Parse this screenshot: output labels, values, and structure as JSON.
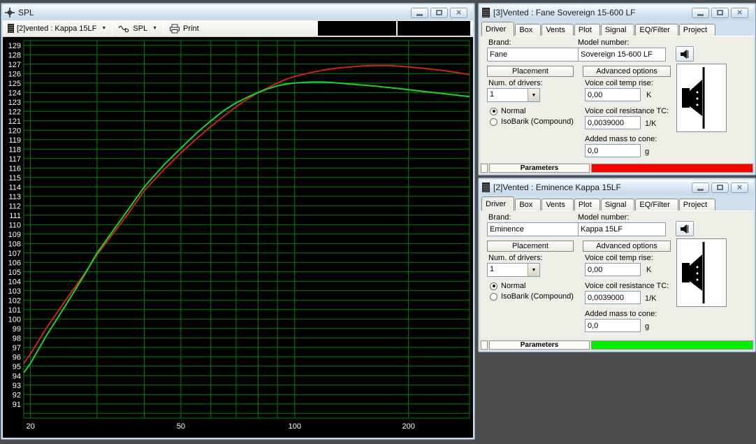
{
  "icons": {
    "dropdown_arrow": "▼",
    "close": "×"
  },
  "spl_window": {
    "title": "SPL",
    "toolbar": {
      "project_selector": "[2]vented : Kappa 15LF",
      "graph_selector": "SPL",
      "print_label": "Print"
    }
  },
  "driver_windows": [
    {
      "title": "[3]Vented : Fane Sovereign 15-600 LF",
      "tabs": [
        "Driver",
        "Box",
        "Vents",
        "Plot",
        "Signal",
        "EQ/Filter",
        "Project"
      ],
      "active_tab": "Driver",
      "brand_label": "Brand:",
      "brand": "Fane",
      "model_label": "Model number:",
      "model": "Sovereign 15-600 LF",
      "placement_button": "Placement",
      "advanced_button": "Advanced options",
      "num_drivers_label": "Num. of drivers:",
      "num_drivers": "1",
      "radio_normal": "Normal",
      "radio_isobarik": "IsoBarik (Compound)",
      "vc_temp_label": "Voice coil temp rise:",
      "vc_temp_value": "0,00",
      "vc_temp_unit": "K",
      "vc_res_label": "Voice coil resistance TC:",
      "vc_res_value": "0,0039000",
      "vc_res_unit": "1/K",
      "added_mass_label": "Added mass to cone:",
      "added_mass_value": "0,0",
      "added_mass_unit": "g",
      "status_label": "Parameters",
      "status_color": "#fd0000"
    },
    {
      "title": "[2]Vented : Eminence Kappa 15LF",
      "tabs": [
        "Driver",
        "Box",
        "Vents",
        "Plot",
        "Signal",
        "EQ/Filter",
        "Project"
      ],
      "active_tab": "Driver",
      "brand_label": "Brand:",
      "brand": "Eminence",
      "model_label": "Model number:",
      "model": "Kappa 15LF",
      "placement_button": "Placement",
      "advanced_button": "Advanced options",
      "num_drivers_label": "Num. of drivers:",
      "num_drivers": "1",
      "radio_normal": "Normal",
      "radio_isobarik": "IsoBarik (Compound)",
      "vc_temp_label": "Voice coil temp rise:",
      "vc_temp_value": "0,00",
      "vc_temp_unit": "K",
      "vc_res_label": "Voice coil resistance TC:",
      "vc_res_value": "0,0039000",
      "vc_res_unit": "1/K",
      "added_mass_label": "Added mass to cone:",
      "added_mass_value": "0,0",
      "added_mass_unit": "g",
      "status_label": "Parameters",
      "status_color": "#00ef00"
    }
  ],
  "chart_data": {
    "type": "line",
    "title": "SPL",
    "xlabel": "",
    "ylabel": "",
    "x_scale": "log",
    "xlim": [
      19.2,
      290
    ],
    "ylim": [
      89.5,
      129.5
    ],
    "grid": true,
    "legend_position": "none",
    "bg_color": "#000000",
    "grid_color": "#008200",
    "tick_text_color": "#ffffff",
    "y_gridline_step": 1,
    "y_label_min": 91,
    "y_label_max": 129,
    "x_gridlines": [
      20,
      30,
      40,
      50,
      60,
      70,
      80,
      90,
      100,
      200
    ],
    "x_tick_labels": [
      20,
      50,
      100,
      200
    ],
    "series": [
      {
        "name": "[3]Vented : Fane Sovereign 15-600 LF",
        "color": "#cd2418",
        "x": [
          19.2,
          20,
          22,
          25,
          28,
          30,
          33,
          36,
          40,
          45,
          50,
          55,
          60,
          65,
          70,
          75,
          80,
          85,
          90,
          95,
          100,
          110,
          120,
          130,
          140,
          150,
          160,
          180,
          200,
          220,
          250,
          270,
          290
        ],
        "y": [
          95.3,
          96.3,
          99.0,
          102.2,
          105.0,
          106.8,
          109.0,
          111.0,
          113.6,
          115.8,
          117.6,
          119.1,
          120.4,
          121.5,
          122.5,
          123.3,
          124.0,
          124.5,
          125.0,
          125.4,
          125.7,
          126.1,
          126.4,
          126.6,
          126.7,
          126.8,
          126.85,
          126.85,
          126.7,
          126.55,
          126.3,
          126.1,
          125.9
        ]
      },
      {
        "name": "[2]Vented : Eminence Kappa 15LF",
        "color": "#1fd327",
        "x": [
          19.2,
          20,
          22,
          25,
          28,
          30,
          33,
          36,
          40,
          45,
          50,
          55,
          60,
          65,
          70,
          75,
          80,
          85,
          90,
          95,
          100,
          110,
          120,
          130,
          140,
          150,
          160,
          180,
          200,
          220,
          250,
          270,
          290
        ],
        "y": [
          94.3,
          95.3,
          98.2,
          101.7,
          104.9,
          107.0,
          109.3,
          111.4,
          114.0,
          116.3,
          118.1,
          119.7,
          121.0,
          122.1,
          122.9,
          123.5,
          124.0,
          124.4,
          124.7,
          124.9,
          125.0,
          125.1,
          125.1,
          125.0,
          124.9,
          124.8,
          124.7,
          124.5,
          124.3,
          124.1,
          123.85,
          123.7,
          123.55
        ]
      }
    ]
  }
}
